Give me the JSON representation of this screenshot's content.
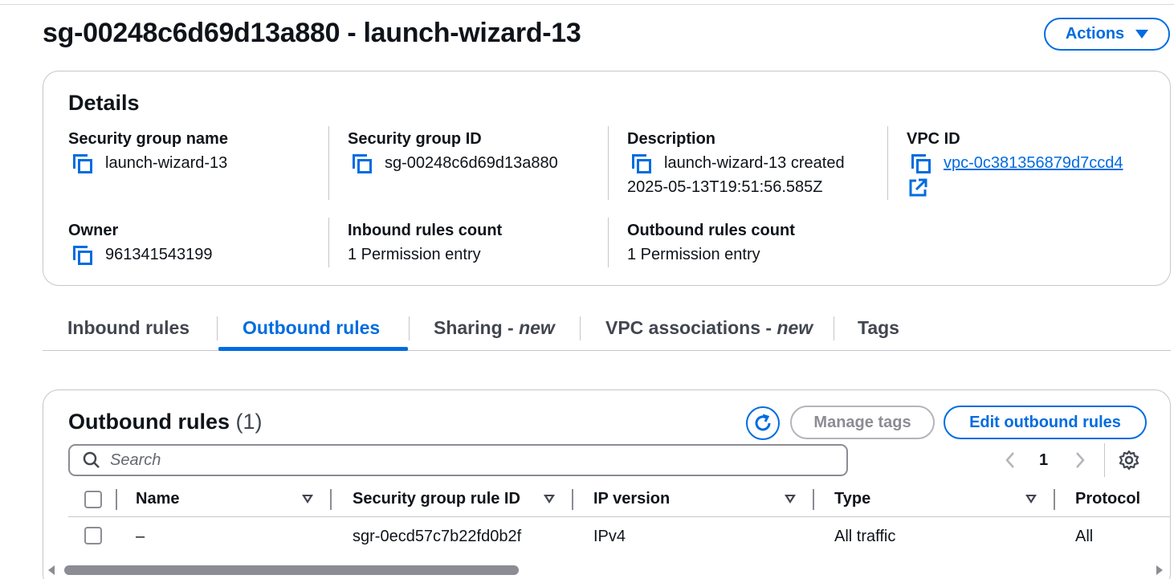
{
  "page": {
    "title": "sg-00248c6d69d13a880 - launch-wizard-13",
    "actions_label": "Actions"
  },
  "details": {
    "heading": "Details",
    "fields": {
      "sg_name": {
        "label": "Security group name",
        "value": "launch-wizard-13"
      },
      "sg_id": {
        "label": "Security group ID",
        "value": "sg-00248c6d69d13a880"
      },
      "description": {
        "label": "Description",
        "value_line1": "launch-wizard-13 created",
        "value_line2": "2025-05-13T19:51:56.585Z"
      },
      "vpc_id": {
        "label": "VPC ID",
        "value": "vpc-0c381356879d7ccd4"
      },
      "owner": {
        "label": "Owner",
        "value": "961341543199"
      },
      "inbound_count": {
        "label": "Inbound rules count",
        "value": "1 Permission entry"
      },
      "outbound_count": {
        "label": "Outbound rules count",
        "value": "1 Permission entry"
      }
    }
  },
  "tabs": [
    {
      "label": "Inbound rules",
      "suffix": ""
    },
    {
      "label": "Outbound rules",
      "suffix": "",
      "active": true
    },
    {
      "label": "Sharing - ",
      "suffix": "new"
    },
    {
      "label": "VPC associations - ",
      "suffix": "new"
    },
    {
      "label": "Tags",
      "suffix": ""
    }
  ],
  "outbound": {
    "heading": "Outbound rules",
    "count": "(1)",
    "manage_tags_label": "Manage tags",
    "edit_label": "Edit outbound rules",
    "search_placeholder": "Search",
    "page": "1",
    "columns": [
      "Name",
      "Security group rule ID",
      "IP version",
      "Type",
      "Protocol"
    ],
    "rows": [
      {
        "name": "–",
        "rule_id": "sgr-0ecd57c7b22fd0b2f",
        "ip_version": "IPv4",
        "type": "All traffic",
        "protocol": "All"
      }
    ]
  },
  "colors": {
    "accent": "#006ce0",
    "text": "#0f141a",
    "border": "#c6c6cd",
    "disabled": "#8c8c94"
  },
  "icons": [
    "copy-icon",
    "external-link-icon",
    "refresh-icon",
    "search-icon",
    "chevron-left-icon",
    "chevron-right-icon",
    "settings-icon",
    "sort-icon",
    "caret-down-icon"
  ]
}
